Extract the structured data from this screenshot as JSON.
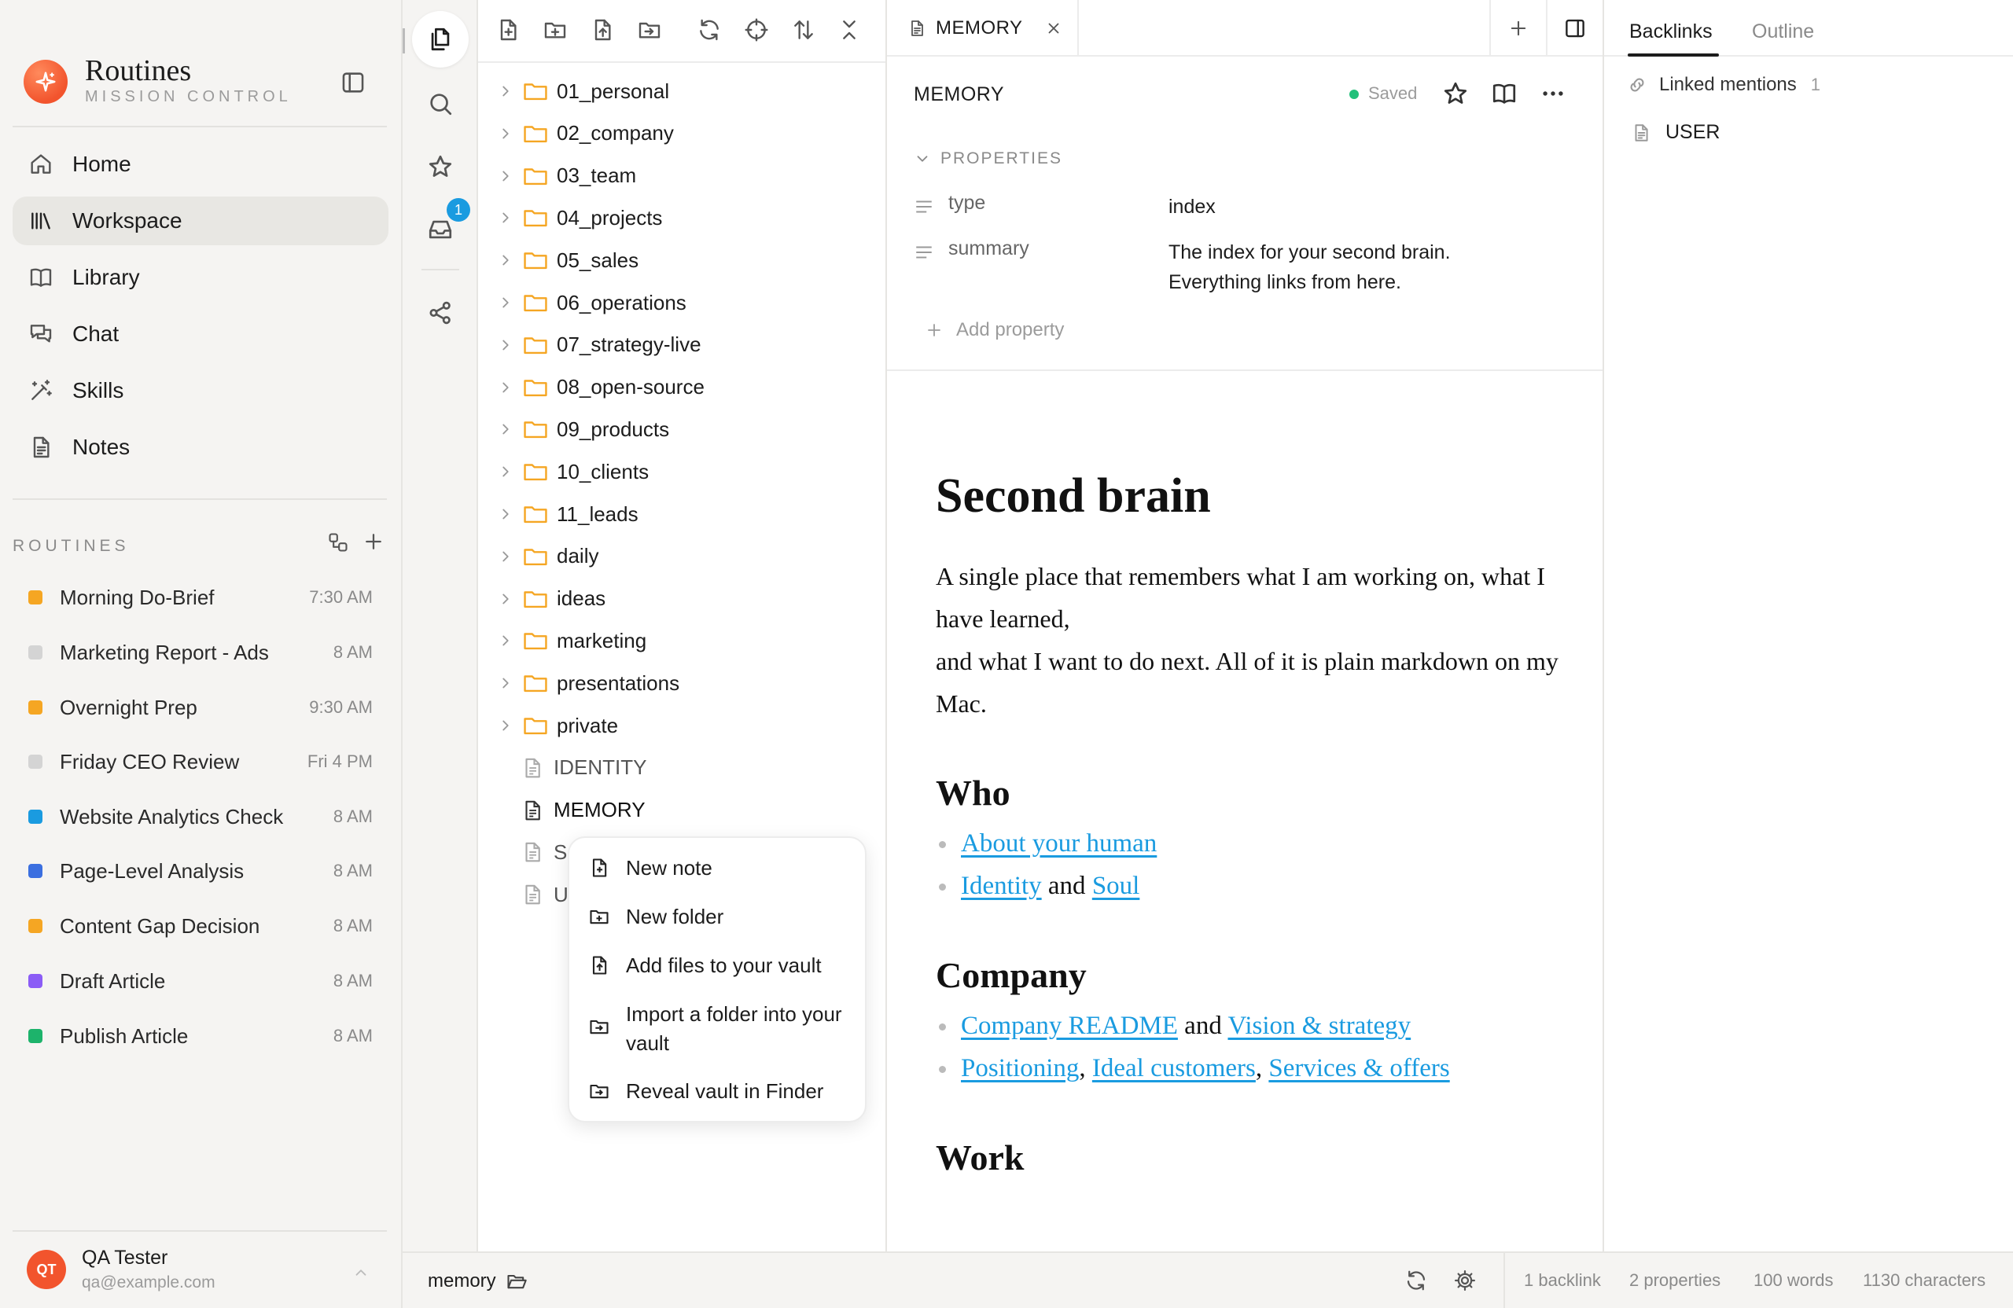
{
  "app": {
    "title": "Routines",
    "subtitle": "MISSION CONTROL"
  },
  "nav": [
    {
      "label": "Home",
      "icon": "home-icon"
    },
    {
      "label": "Workspace",
      "icon": "library-icon",
      "active": true
    },
    {
      "label": "Library",
      "icon": "book-icon"
    },
    {
      "label": "Chat",
      "icon": "chat-icon"
    },
    {
      "label": "Skills",
      "icon": "magic-wand-icon"
    },
    {
      "label": "Notes",
      "icon": "document-icon"
    }
  ],
  "routines": {
    "heading": "ROUTINES",
    "items": [
      {
        "name": "Morning Do-Brief",
        "time": "7:30 AM",
        "color": "#f5a623"
      },
      {
        "name": "Marketing Report - Ads",
        "time": "8 AM",
        "color": "#d4d4d4"
      },
      {
        "name": "Overnight Prep",
        "time": "9:30 AM",
        "color": "#f5a623"
      },
      {
        "name": "Friday CEO Review",
        "time": "Fri 4 PM",
        "color": "#d4d4d4"
      },
      {
        "name": "Website Analytics Check",
        "time": "8 AM",
        "color": "#1a9be0"
      },
      {
        "name": "Page-Level Analysis",
        "time": "8 AM",
        "color": "#3b6fe0"
      },
      {
        "name": "Content Gap Decision",
        "time": "8 AM",
        "color": "#f5a623"
      },
      {
        "name": "Draft Article",
        "time": "8 AM",
        "color": "#8b5cf6"
      },
      {
        "name": "Publish Article",
        "time": "8 AM",
        "color": "#1db36b"
      }
    ]
  },
  "user": {
    "initials": "QT",
    "name": "QA Tester",
    "email": "qa@example.com"
  },
  "rail": {
    "inbox_badge": "1"
  },
  "tree": {
    "folders": [
      "01_personal",
      "02_company",
      "03_team",
      "04_projects",
      "05_sales",
      "06_operations",
      "07_strategy-live",
      "08_open-source",
      "09_products",
      "10_clients",
      "11_leads",
      "daily",
      "ideas",
      "marketing",
      "presentations",
      "private"
    ],
    "files": [
      "IDENTITY",
      "MEMORY",
      "S",
      "U"
    ]
  },
  "context_menu": [
    {
      "label": "New note",
      "icon": "new-note-icon"
    },
    {
      "label": "New folder",
      "icon": "new-folder-icon"
    },
    {
      "label": "Add files to your vault",
      "icon": "add-file-icon"
    },
    {
      "label": "Import a folder into your vault",
      "icon": "import-folder-icon"
    },
    {
      "label": "Reveal vault in Finder",
      "icon": "reveal-folder-icon"
    }
  ],
  "editor": {
    "tab_label": "MEMORY",
    "doc_title": "MEMORY",
    "saved": "Saved",
    "properties_label": "PROPERTIES",
    "properties": [
      {
        "key": "type",
        "value": "index"
      },
      {
        "key": "summary",
        "value": "The index for your second brain. Everything links from here."
      }
    ],
    "add_property": "Add property",
    "h1": "Second brain",
    "intro_1": "A single place that remembers what I am working on, what I have learned,",
    "intro_2": "and what I want to do next. All of it is plain markdown on my Mac.",
    "who": {
      "heading": "Who",
      "link1": "About your human",
      "link2": "Identity",
      "and": "and",
      "link3": "Soul"
    },
    "company": {
      "heading": "Company",
      "link1": "Company README",
      "and": "and",
      "link2": "Vision & strategy",
      "link3": "Positioning",
      "link4": "Ideal customers",
      "link5": "Services & offers",
      "comma": ","
    },
    "next_heading": "Work"
  },
  "right_panel": {
    "tab_backlinks": "Backlinks",
    "tab_outline": "Outline",
    "linked_mentions": "Linked mentions",
    "linked_count": "1",
    "backlink_item": "USER"
  },
  "statusbar": {
    "path": "memory",
    "backlinks": "1 backlink",
    "properties": "2 properties",
    "words": "100 words",
    "characters": "1130 characters"
  }
}
